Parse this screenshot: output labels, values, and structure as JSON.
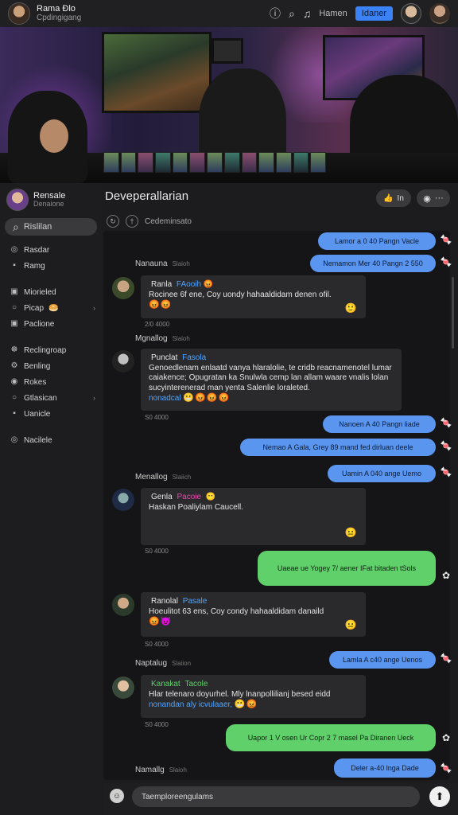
{
  "topbar": {
    "title": "Rama Ðlo",
    "subtitle": "Cpdingigang",
    "user_label": "Hamen",
    "button_label": "Idaner",
    "icons": [
      "info-icon",
      "search-icon",
      "bell-icon"
    ]
  },
  "sidebar": {
    "profile_name": "Rensale",
    "profile_sub": "Denaione",
    "search_label": "Rislilan",
    "items": [
      {
        "label": "Rasdar",
        "icon": "circle-icon"
      },
      {
        "label": "Ramg",
        "icon": "square-icon"
      },
      {
        "label": "Miorieled",
        "icon": "square-icon"
      },
      {
        "label": "Picap",
        "icon": "circle-icon",
        "emoji": "🥯"
      },
      {
        "label": "Paclione",
        "icon": "square-icon"
      },
      {
        "label": "Reclingroap",
        "icon": "gamepad-icon"
      },
      {
        "label": "Benling",
        "icon": "gear-icon"
      },
      {
        "label": "Rokes",
        "icon": "circle-icon"
      },
      {
        "label": "Gtlasican",
        "icon": "circle-icon"
      },
      {
        "label": "Uanicle",
        "icon": "square-icon"
      },
      {
        "label": "Nacilele",
        "icon": "circle-icon"
      }
    ]
  },
  "channel": {
    "title": "Deveperallarian",
    "subtitle": "Cedeminsato",
    "like_label": "In",
    "more_label": "···"
  },
  "messages": {
    "out1": "Lamor a 0 40 Pangn Vacle",
    "out2": "Nemamon Mer 40 Pangn 2 550",
    "sender1": "Nanauna",
    "sender1_tag": "Slaioh",
    "m1_name": "Ranla",
    "m1_tag": "FAooih",
    "m1_text": "Rocinee 6f ene, Coy uondy hahaaldidam denen ofil.",
    "m1_emoji": "😡😡",
    "m1_react": "🙂",
    "m1_time": "2/0 4000",
    "sender2": "Mgnallog",
    "sender2_tag": "Slaioh",
    "m2_name": "Punclat",
    "m2_tag": "Fasola",
    "m2_text": "Genoedlenam enlaatd vanya hlaralolie, te cridb reacnamenotel lumar caiakence; Opugratan ka Snulwla cemp lan allam waare vnalis lolan sucyinterenerad man yenta Salenlie loraleted.",
    "m2_link": "nonadcal",
    "m2_emoji": "😬😡😡😡",
    "m2_time": "S0 4000",
    "out3": "Nanoen A 40 Pangn liade",
    "out4": "Nemao A Gala, Grey 89 mand fed dirluan deele",
    "out5": "Uamin A 040 ange Uemo",
    "sender3": "Menallog",
    "sender3_tag": "Slaiich",
    "m3_name": "Genla",
    "m3_tag": "Pacoie",
    "m3_text": "Haskan Poaliylam Caucell.",
    "m3_emoji": "😶",
    "m3_react": "😐",
    "m3_time": "S0 4000",
    "out6": "Uaeae ue Yogey 7/ aener IFat bitaden tSols",
    "m4_name": "Ranolal",
    "m4_tag": "Pasale",
    "m4_text": "Hoeulitot 63 ens, Coy condy hahaaldidam danaild",
    "m4_emoji": "😡😈",
    "m4_react": "😐",
    "m4_time": "S0 4000",
    "out7": "Lamla A c40 ange Uenos",
    "sender5": "Naptalug",
    "sender5_tag": "Slaiion",
    "m5_name": "Kanakat",
    "m5_tag": "Tacole",
    "m5_text": "Hlar telenaro doyurhel. Mly lnanpollilianj besed eidd",
    "m5_link": "nonandan aly icvulaaer,",
    "m5_emoji": "😬😡",
    "m5_time": "S0 4000",
    "out8": "Uapor 1 V osen Ur Copr 2 7 masel Pa Diranen Ueck",
    "sender6": "Namallg",
    "sender6_tag": "Slaioh",
    "out9": "Deler a-40 lnga Dade"
  },
  "composer": {
    "placeholder": "Taemploreengulams",
    "send_icon": "send-icon"
  }
}
